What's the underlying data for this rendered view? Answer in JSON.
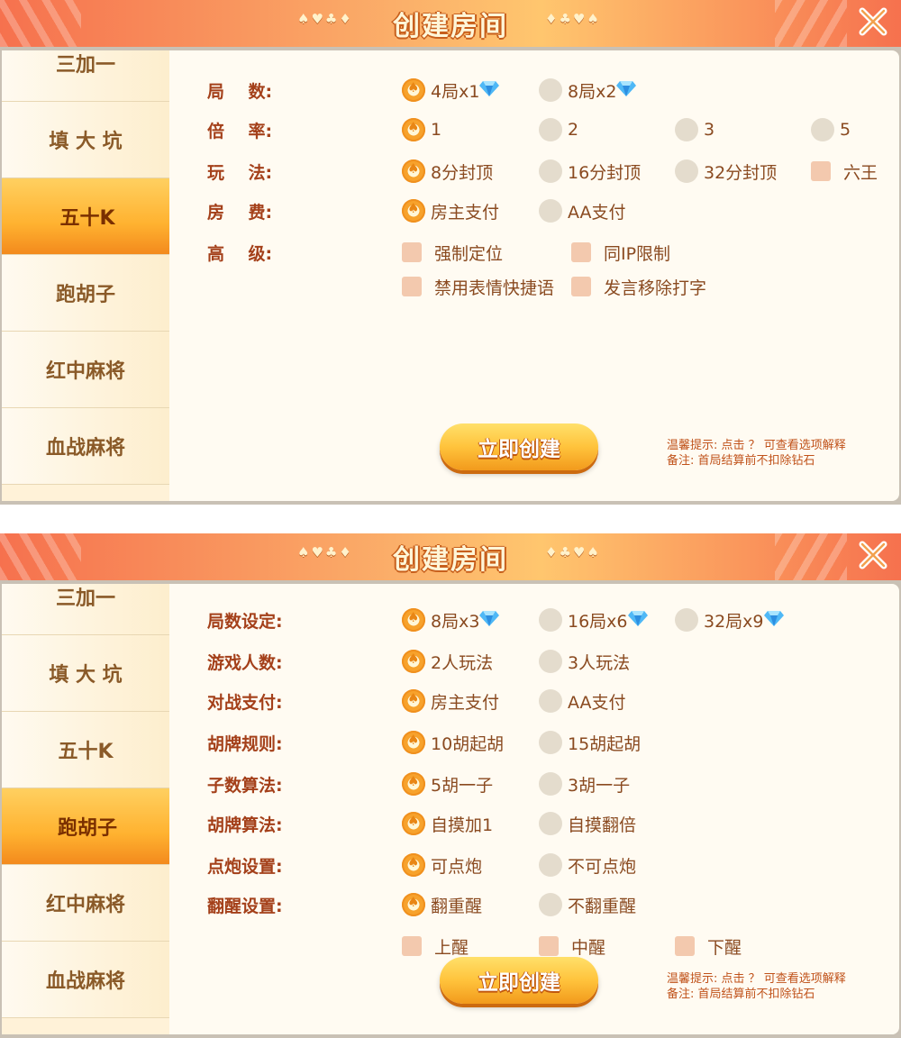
{
  "panel1": {
    "title": "创建房间",
    "suits_left": "♠♥♣♦",
    "suits_right": "♦♣♥♠",
    "sidebar": [
      "三加一",
      "填 大 坑",
      "五十K",
      "跑胡子",
      "红中麻将",
      "血战麻将"
    ],
    "active_index": 2,
    "rows": [
      {
        "label": "局    数:",
        "options": [
          {
            "text": "4局x1",
            "gem": true,
            "on": true
          },
          {
            "text": "8局x2",
            "gem": true,
            "on": false
          }
        ]
      },
      {
        "label": "倍    率:",
        "options": [
          {
            "text": "1",
            "on": true
          },
          {
            "text": "2",
            "on": false
          },
          {
            "text": "3",
            "on": false
          },
          {
            "text": "5",
            "on": false
          }
        ]
      },
      {
        "label": "玩    法:",
        "options": [
          {
            "text": "8分封顶",
            "on": true
          },
          {
            "text": "16分封顶",
            "on": false
          },
          {
            "text": "32分封顶",
            "on": false
          },
          {
            "text": "六王",
            "check": true
          }
        ]
      },
      {
        "label": "房    费:",
        "options": [
          {
            "text": "房主支付",
            "on": true
          },
          {
            "text": "AA支付",
            "on": false
          }
        ]
      },
      {
        "label": "高    级:",
        "options": [
          {
            "text": "强制定位",
            "check": true
          },
          {
            "text": "同IP限制",
            "check": true
          }
        ]
      },
      {
        "label": "",
        "options": [
          {
            "text": "禁用表情快捷语",
            "check": true
          },
          {
            "text": "发言移除打字",
            "check": true
          }
        ]
      }
    ],
    "create_button": "立即创建",
    "hint_line1": "温馨提示: 点击 ？ 可查看选项解释",
    "hint_line2": "备注: 首局结算前不扣除钻石"
  },
  "panel2": {
    "title": "创建房间",
    "suits_left": "♠♥♣♦",
    "suits_right": "♦♣♥♠",
    "sidebar": [
      "三加一",
      "填 大 坑",
      "五十K",
      "跑胡子",
      "红中麻将",
      "血战麻将"
    ],
    "active_index": 3,
    "rows": [
      {
        "label": "局数设定:",
        "options": [
          {
            "text": "8局x3",
            "gem": true,
            "on": true
          },
          {
            "text": "16局x6",
            "gem": true,
            "on": false
          },
          {
            "text": "32局x9",
            "gem": true,
            "on": false
          }
        ]
      },
      {
        "label": "游戏人数:",
        "options": [
          {
            "text": "2人玩法",
            "on": true
          },
          {
            "text": "3人玩法",
            "on": false
          }
        ]
      },
      {
        "label": "对战支付:",
        "options": [
          {
            "text": "房主支付",
            "on": true
          },
          {
            "text": "AA支付",
            "on": false
          }
        ]
      },
      {
        "label": "胡牌规则:",
        "options": [
          {
            "text": "10胡起胡",
            "on": true
          },
          {
            "text": "15胡起胡",
            "on": false
          }
        ]
      },
      {
        "label": "子数算法:",
        "options": [
          {
            "text": "5胡一子",
            "on": true
          },
          {
            "text": "3胡一子",
            "on": false
          }
        ]
      },
      {
        "label": "胡牌算法:",
        "options": [
          {
            "text": "自摸加1",
            "on": true
          },
          {
            "text": "自摸翻倍",
            "on": false
          }
        ]
      },
      {
        "label": "点炮设置:",
        "options": [
          {
            "text": "可点炮",
            "on": true
          },
          {
            "text": "不可点炮",
            "on": false
          }
        ]
      },
      {
        "label": "翻醒设置:",
        "options": [
          {
            "text": "翻重醒",
            "on": true
          },
          {
            "text": "不翻重醒",
            "on": false
          }
        ]
      },
      {
        "label": "",
        "options": [
          {
            "text": "上醒",
            "check": true
          },
          {
            "text": "中醒",
            "check": true
          },
          {
            "text": "下醒",
            "check": true
          }
        ]
      }
    ],
    "create_button": "立即创建",
    "hint_line1": "温馨提示: 点击 ？ 可查看选项解释",
    "hint_line2": "备注: 首局结算前不扣除钻石"
  },
  "colors": {
    "accent": "#f7a22c",
    "label": "#a4401a",
    "text": "#8a4a20",
    "header": "#f6714e"
  },
  "icons": {
    "close": "close-x-icon",
    "gem": "diamond-icon",
    "radio_selected": "spade-radio-icon"
  }
}
